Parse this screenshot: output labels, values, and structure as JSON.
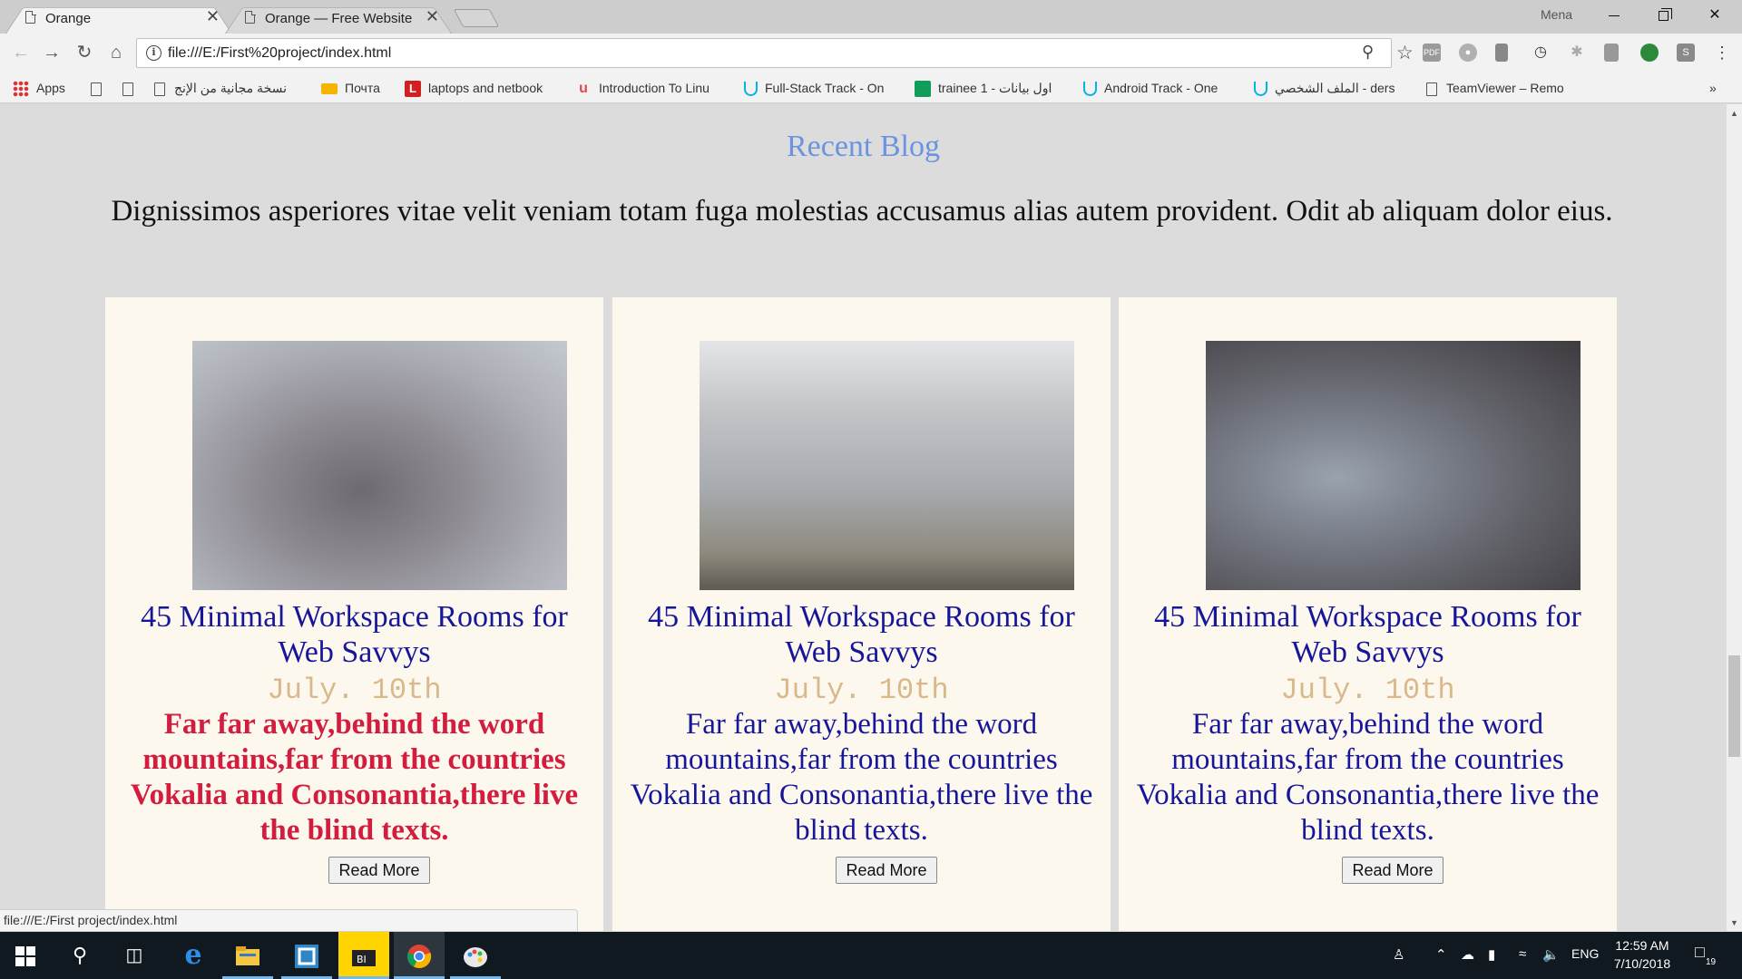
{
  "browser": {
    "tabs": [
      {
        "title": "Orange",
        "active": true
      },
      {
        "title": "Orange — Free Website T",
        "active": false
      }
    ],
    "profile_name": "Mena",
    "window_controls": {
      "minimize": "—",
      "close": "✕"
    },
    "omnibox": {
      "url": "file:///E:/First%20project/index.html"
    },
    "bookmarks": [
      {
        "label": "Apps",
        "icon": "apps-grid-icon"
      },
      {
        "label": "",
        "icon": "page-icon"
      },
      {
        "label": "",
        "icon": "page-icon"
      },
      {
        "label": "نسخة مجانية من الإنج",
        "icon": "page-icon"
      },
      {
        "label": "Почта",
        "icon": "mail-icon"
      },
      {
        "label": "laptops and netbook",
        "icon": "l-logo-icon"
      },
      {
        "label": "Introduction To Linu",
        "icon": "udacity-icon"
      },
      {
        "label": "Full-Stack Track - On",
        "icon": "udacity-icon"
      },
      {
        "label": "trainee 1 - اول بيانات",
        "icon": "sheets-icon"
      },
      {
        "label": "Android Track - One",
        "icon": "udacity-icon"
      },
      {
        "label": "الملف الشخصي - ders",
        "icon": "udacity-icon"
      },
      {
        "label": "TeamViewer – Remo",
        "icon": "page-icon"
      }
    ],
    "bookmarks_overflow": "»",
    "status_url": "file:///E:/First project/index.html"
  },
  "page": {
    "section_title": "Recent Blog",
    "section_description": "Dignissimos asperiores vitae velit veniam totam fuga molestias accusamus alias autem provident. Odit ab aliquam dolor eius.",
    "cards": [
      {
        "title": "45 Minimal Workspace Rooms for Web Savvys",
        "date": "July. 10th",
        "text": "Far far away,behind the word mountains,far from the countries Vokalia and Consonantia,there live the blind texts.",
        "button": "Read More",
        "highlighted": true
      },
      {
        "title": "45 Minimal Workspace Rooms for Web Savvys",
        "date": "July. 10th",
        "text": "Far far away,behind the word mountains,far from the countries Vokalia and Consonantia,there live the blind texts.",
        "button": "Read More",
        "highlighted": false
      },
      {
        "title": "45 Minimal Workspace Rooms for Web Savvys",
        "date": "July. 10th",
        "text": "Far far away,behind the word mountains,far from the countries Vokalia and Consonantia,there live the blind texts.",
        "button": "Read More",
        "highlighted": false
      }
    ],
    "colors": {
      "section_title": "#6b93e0",
      "card_title": "#16169a",
      "card_date": "#d9b98b",
      "highlight_text": "#d31d3f",
      "card_background": "#fdf8ed"
    }
  },
  "taskbar": {
    "apps": [
      "windows-start-icon",
      "search-icon",
      "task-view-icon",
      "edge-icon",
      "file-explorer-icon",
      "app-icon",
      "video-editor-icon",
      "chrome-icon",
      "paint-icon"
    ],
    "tray": {
      "language": "ENG",
      "time": "12:59 AM",
      "date": "7/10/2018",
      "notifications": "19"
    }
  }
}
